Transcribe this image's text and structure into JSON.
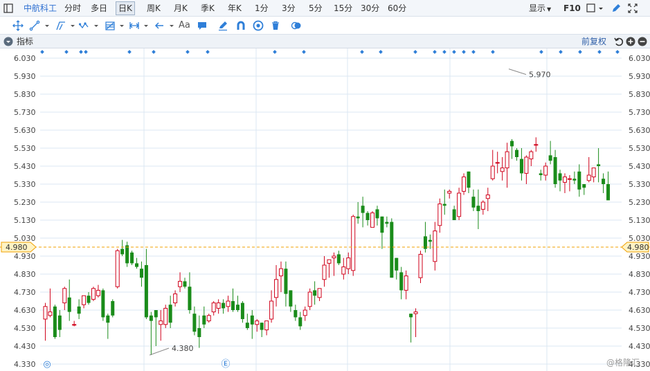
{
  "toolbar": {
    "stock_name": "中航科工",
    "periods": [
      "分时",
      "多日",
      "日K",
      "周K",
      "月K",
      "季K",
      "年K",
      "1分",
      "3分",
      "5分",
      "15分",
      "30分",
      "60分"
    ],
    "active_period": "日K",
    "display_label": "显示",
    "f10_label": "F10"
  },
  "drawing_toolbar": {
    "text_tool_label": "Aa"
  },
  "indicator_bar": {
    "label": "指标",
    "adjust_label": "前复权"
  },
  "colors": {
    "up": "#d0021b",
    "down": "#1a8c1a",
    "grid": "#dbe7f3",
    "axis_text": "#444444",
    "price_line": "#f0a000",
    "price_tag_bg": "#fff3c4",
    "accent_blue": "#2f7fd8"
  },
  "chart_data": {
    "type": "candlestick",
    "y_axis_ticks": [
      "6.030",
      "5.930",
      "5.830",
      "5.730",
      "5.630",
      "5.530",
      "5.430",
      "5.330",
      "5.230",
      "5.130",
      "5.030",
      "4.930",
      "4.830",
      "4.730",
      "4.630",
      "4.530",
      "4.430",
      "4.330"
    ],
    "ylim": [
      4.33,
      6.03
    ],
    "current_price": 4.98,
    "current_price_label": "4.980",
    "high_annotation": {
      "label": "5.970",
      "value": 5.97
    },
    "low_annotation": {
      "label": "4.380",
      "value": 4.38
    },
    "event_markers": [
      "◎",
      "Ⓔ"
    ],
    "watermark": "@格隆汇",
    "candles": [
      [
        4.58,
        4.65,
        4.46,
        4.67
      ],
      [
        4.6,
        4.62,
        4.59,
        4.75
      ],
      [
        4.65,
        4.48,
        4.47,
        4.66
      ],
      [
        4.6,
        4.52,
        4.48,
        4.63
      ],
      [
        4.67,
        4.75,
        4.63,
        4.76
      ],
      [
        4.7,
        4.62,
        4.57,
        4.8
      ],
      [
        4.55,
        4.55,
        4.54,
        4.57
      ],
      [
        4.65,
        4.61,
        4.58,
        4.69
      ],
      [
        4.66,
        4.71,
        4.64,
        4.71
      ],
      [
        4.71,
        4.67,
        4.66,
        4.73
      ],
      [
        4.69,
        4.75,
        4.68,
        4.76
      ],
      [
        4.71,
        4.74,
        4.7,
        4.77
      ],
      [
        4.74,
        4.59,
        4.57,
        4.75
      ],
      [
        4.6,
        4.56,
        4.47,
        4.61
      ],
      [
        4.68,
        4.6,
        4.59,
        4.69
      ],
      [
        4.76,
        4.96,
        4.75,
        4.97
      ],
      [
        4.97,
        4.94,
        4.93,
        5.02
      ],
      [
        4.99,
        4.89,
        4.87,
        5.01
      ],
      [
        4.95,
        4.89,
        4.88,
        4.96
      ],
      [
        4.89,
        4.87,
        4.86,
        4.92
      ],
      [
        4.86,
        4.81,
        4.76,
        4.9
      ],
      [
        4.88,
        4.59,
        4.58,
        4.97
      ],
      [
        4.6,
        4.57,
        4.38,
        4.62
      ],
      [
        4.63,
        4.59,
        4.43,
        4.63
      ],
      [
        4.55,
        4.57,
        4.46,
        4.63
      ],
      [
        4.55,
        4.64,
        4.53,
        4.66
      ],
      [
        4.66,
        4.56,
        4.53,
        4.71
      ],
      [
        4.67,
        4.72,
        4.65,
        4.74
      ],
      [
        4.76,
        4.79,
        4.73,
        4.84
      ],
      [
        4.79,
        4.76,
        4.75,
        4.81
      ],
      [
        4.76,
        4.63,
        4.61,
        4.84
      ],
      [
        4.61,
        4.51,
        4.49,
        4.65
      ],
      [
        4.53,
        4.48,
        4.42,
        4.6
      ],
      [
        4.6,
        4.55,
        4.53,
        4.65
      ],
      [
        4.57,
        4.6,
        4.56,
        4.61
      ],
      [
        4.62,
        4.67,
        4.6,
        4.68
      ],
      [
        4.64,
        4.67,
        4.61,
        4.69
      ],
      [
        4.67,
        4.64,
        4.61,
        4.69
      ],
      [
        4.65,
        4.68,
        4.62,
        4.71
      ],
      [
        4.68,
        4.63,
        4.62,
        4.75
      ],
      [
        4.66,
        4.63,
        4.62,
        4.71
      ],
      [
        4.67,
        4.58,
        4.56,
        4.68
      ],
      [
        4.56,
        4.53,
        4.52,
        4.61
      ],
      [
        4.6,
        4.55,
        4.47,
        4.63
      ],
      [
        4.55,
        4.57,
        4.51,
        4.58
      ],
      [
        4.56,
        4.52,
        4.48,
        4.56
      ],
      [
        4.52,
        4.57,
        4.49,
        4.57
      ],
      [
        4.58,
        4.68,
        4.56,
        4.74
      ],
      [
        4.7,
        4.8,
        4.65,
        4.88
      ],
      [
        4.82,
        4.86,
        4.73,
        4.9
      ],
      [
        4.86,
        4.72,
        4.65,
        4.9
      ],
      [
        4.74,
        4.65,
        4.62,
        4.74
      ],
      [
        4.63,
        4.59,
        4.57,
        4.66
      ],
      [
        4.59,
        4.54,
        4.52,
        4.62
      ],
      [
        4.6,
        4.63,
        4.57,
        4.65
      ],
      [
        4.65,
        4.73,
        4.63,
        4.75
      ],
      [
        4.74,
        4.71,
        4.66,
        4.79
      ],
      [
        4.7,
        4.75,
        4.68,
        4.75
      ],
      [
        4.8,
        4.88,
        4.76,
        4.93
      ],
      [
        4.89,
        4.91,
        4.81,
        4.91
      ],
      [
        4.92,
        4.93,
        4.82,
        4.95
      ],
      [
        4.94,
        4.89,
        4.88,
        4.96
      ],
      [
        4.83,
        4.87,
        4.8,
        4.92
      ],
      [
        4.86,
        4.92,
        4.83,
        4.95
      ],
      [
        4.85,
        5.15,
        4.82,
        5.16
      ],
      [
        5.15,
        5.14,
        5.11,
        5.23
      ],
      [
        5.21,
        5.17,
        5.09,
        5.26
      ],
      [
        5.17,
        5.13,
        5.1,
        5.18
      ],
      [
        5.09,
        5.17,
        5.09,
        5.18
      ],
      [
        5.19,
        5.14,
        5.1,
        5.21
      ],
      [
        5.15,
        5.06,
        4.97,
        5.15
      ],
      [
        5.12,
        5.11,
        5.09,
        5.15
      ],
      [
        5.12,
        4.81,
        4.81,
        5.14
      ],
      [
        4.92,
        4.85,
        4.8,
        4.92
      ],
      [
        4.84,
        4.74,
        4.69,
        4.87
      ],
      [
        4.74,
        4.82,
        4.69,
        4.85
      ],
      [
        4.61,
        4.59,
        4.45,
        4.61
      ],
      [
        4.61,
        4.62,
        4.48,
        4.64
      ],
      [
        4.81,
        4.94,
        4.78,
        4.96
      ],
      [
        5.04,
        4.97,
        4.95,
        5.12
      ],
      [
        5.02,
        5.01,
        4.97,
        5.05
      ],
      [
        4.9,
        5.07,
        4.85,
        5.12
      ],
      [
        5.1,
        5.22,
        5.06,
        5.25
      ],
      [
        5.22,
        5.21,
        5.16,
        5.3
      ],
      [
        5.28,
        5.29,
        5.25,
        5.3
      ],
      [
        5.19,
        5.13,
        5.13,
        5.21
      ],
      [
        5.15,
        5.28,
        5.13,
        5.31
      ],
      [
        5.29,
        5.37,
        5.27,
        5.39
      ],
      [
        5.4,
        5.31,
        5.28,
        5.4
      ],
      [
        5.26,
        5.2,
        5.18,
        5.3
      ],
      [
        5.21,
        5.18,
        5.08,
        5.3
      ],
      [
        5.19,
        5.23,
        5.16,
        5.24
      ],
      [
        5.25,
        5.27,
        5.18,
        5.31
      ],
      [
        5.36,
        5.43,
        5.35,
        5.52
      ],
      [
        5.45,
        5.45,
        5.39,
        5.51
      ],
      [
        5.4,
        5.42,
        5.35,
        5.48
      ],
      [
        5.42,
        5.51,
        5.31,
        5.56
      ],
      [
        5.57,
        5.54,
        5.47,
        5.58
      ],
      [
        5.52,
        5.48,
        5.46,
        5.53
      ],
      [
        5.47,
        5.39,
        5.35,
        5.53
      ],
      [
        5.39,
        5.48,
        5.33,
        5.49
      ],
      [
        5.47,
        5.51,
        5.43,
        5.52
      ],
      [
        5.55,
        5.55,
        5.51,
        5.59
      ],
      [
        5.39,
        5.38,
        5.35,
        5.41
      ],
      [
        5.38,
        5.43,
        5.35,
        5.45
      ],
      [
        5.49,
        5.46,
        5.44,
        5.57
      ],
      [
        5.48,
        5.33,
        5.31,
        5.52
      ],
      [
        5.39,
        5.35,
        5.29,
        5.41
      ],
      [
        5.34,
        5.37,
        5.28,
        5.39
      ],
      [
        5.36,
        5.36,
        5.29,
        5.38
      ],
      [
        5.36,
        5.35,
        5.33,
        5.4
      ],
      [
        5.4,
        5.3,
        5.26,
        5.44
      ],
      [
        5.33,
        5.31,
        5.27,
        5.33
      ],
      [
        5.35,
        5.38,
        5.34,
        5.48
      ],
      [
        5.37,
        5.42,
        5.34,
        5.42
      ],
      [
        5.44,
        5.43,
        5.34,
        5.53
      ],
      [
        5.36,
        5.33,
        5.28,
        5.39
      ],
      [
        5.33,
        5.24,
        5.25,
        5.4
      ]
    ]
  }
}
